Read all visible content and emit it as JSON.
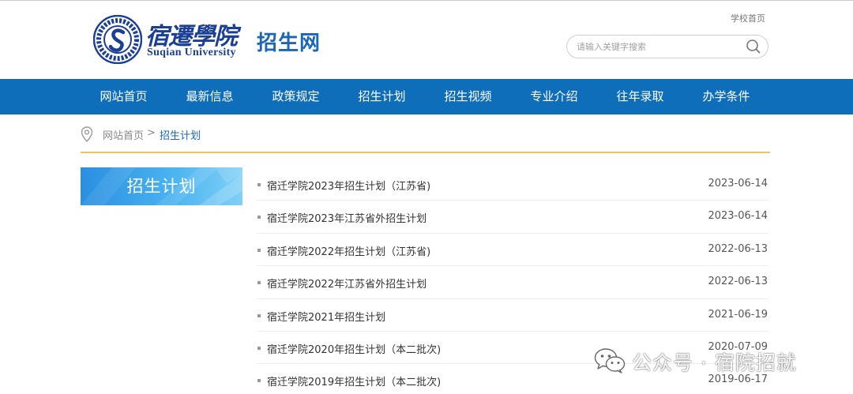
{
  "header": {
    "logo_cn": "宿遷學院",
    "logo_en": "Suqian University",
    "site_name": "招生网",
    "school_home": "学校首页",
    "search_placeholder": "请输入关键字搜索"
  },
  "nav": {
    "items": [
      "网站首页",
      "最新信息",
      "政策规定",
      "招生计划",
      "招生视频",
      "专业介绍",
      "往年录取",
      "办学条件"
    ]
  },
  "breadcrumb": {
    "home": "网站首页",
    "separator": ">",
    "current": "招生计划"
  },
  "sidebar": {
    "title": "招生计划"
  },
  "list": {
    "items": [
      {
        "title": "宿迁学院2023年招生计划（江苏省)",
        "date": "2023-06-14"
      },
      {
        "title": "宿迁学院2023年江苏省外招生计划",
        "date": "2023-06-14"
      },
      {
        "title": "宿迁学院2022年招生计划（江苏省)",
        "date": "2022-06-13"
      },
      {
        "title": "宿迁学院2022年江苏省外招生计划",
        "date": "2022-06-13"
      },
      {
        "title": "宿迁学院2021年招生计划",
        "date": "2021-06-19"
      },
      {
        "title": "宿迁学院2020年招生计划（本二批次)",
        "date": "2020-07-09"
      },
      {
        "title": "宿迁学院2019年招生计划（本二批次)",
        "date": "2019-06-17"
      }
    ]
  },
  "watermark": {
    "text": "公众号 · 宿院招就"
  },
  "colors": {
    "nav_bg": "#0f6eb9",
    "brand_blue": "#1a66b7",
    "logo_blue": "#1b3f96",
    "divider_gold": "#f0c45c"
  },
  "icons": [
    "search-icon",
    "location-pin-icon",
    "wechat-icon",
    "university-seal-icon"
  ]
}
